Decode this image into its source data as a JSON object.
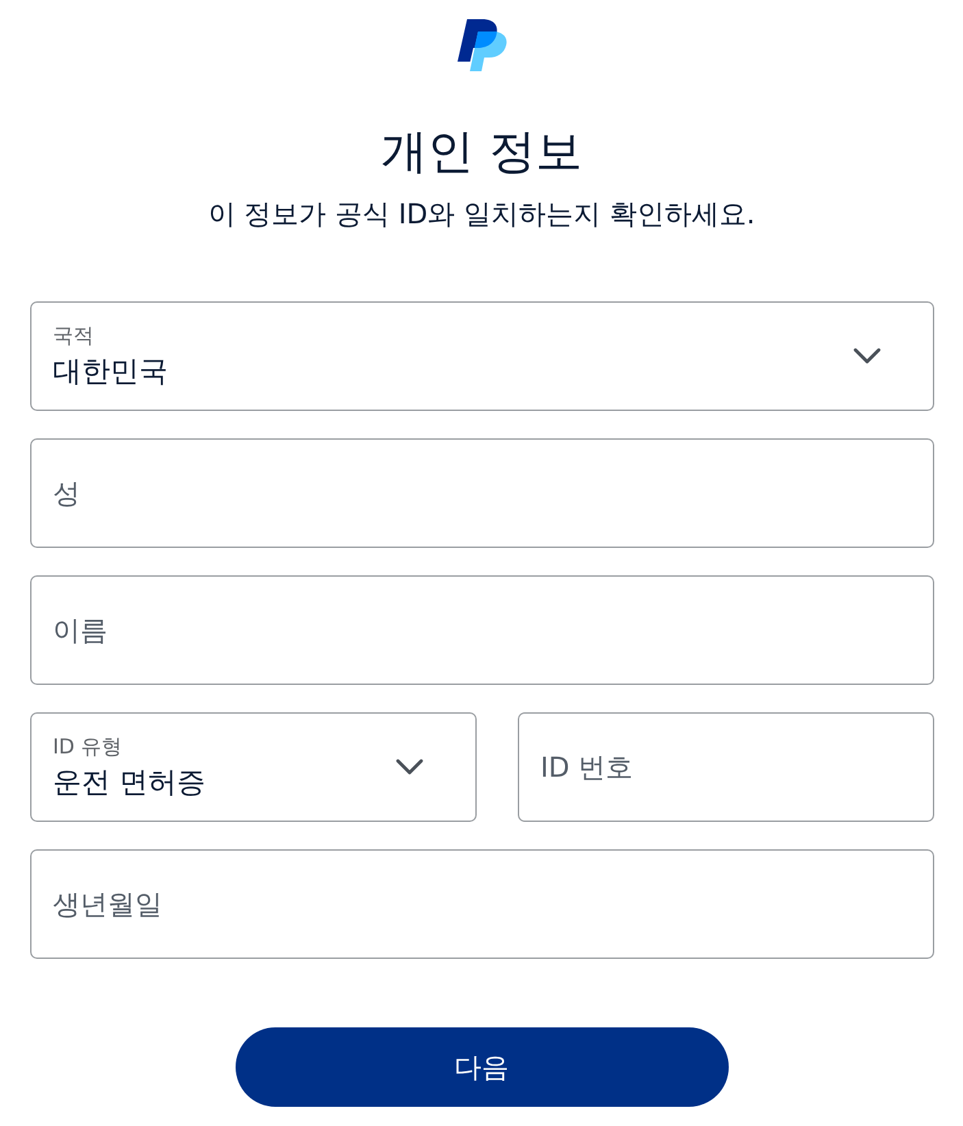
{
  "header": {
    "title": "개인 정보",
    "subtitle": "이 정보가 공식 ID와 일치하는지 확인하세요."
  },
  "rows": [
    {
      "fields": [
        {
          "kind": "select",
          "label": "국적",
          "value": "대한민국"
        }
      ]
    },
    {
      "fields": [
        {
          "kind": "text",
          "placeholder": "성"
        }
      ]
    },
    {
      "fields": [
        {
          "kind": "text",
          "placeholder": "이름"
        }
      ]
    },
    {
      "fields": [
        {
          "kind": "select",
          "label": "ID 유형",
          "value": "운전 면허증"
        },
        {
          "kind": "text",
          "placeholder": "ID 번호"
        }
      ]
    },
    {
      "fields": [
        {
          "kind": "text",
          "placeholder": "생년월일"
        }
      ]
    }
  ],
  "button": {
    "label": "다음"
  }
}
